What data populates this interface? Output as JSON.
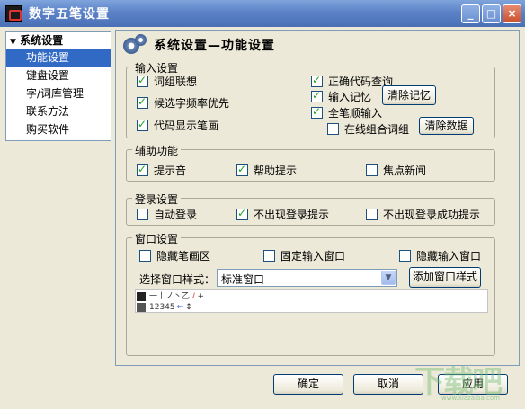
{
  "window": {
    "title": "数字五笔设置",
    "minimize": "_",
    "maximize": "□",
    "close": "×"
  },
  "nav": {
    "header": "系统设置",
    "items": [
      {
        "label": "功能设置",
        "selected": true
      },
      {
        "label": "键盘设置",
        "selected": false
      },
      {
        "label": "字/词库管理",
        "selected": false
      },
      {
        "label": "联系方法",
        "selected": false
      },
      {
        "label": "购买软件",
        "selected": false
      }
    ]
  },
  "panel": {
    "title": "系统设置—功能设置"
  },
  "input_group": {
    "label": "输入设置",
    "options": [
      {
        "label": "词组联想",
        "checked": true
      },
      {
        "label": "候选字频率优先",
        "checked": true
      },
      {
        "label": "代码显示笔画",
        "checked": true
      },
      {
        "label": "正确代码查询",
        "checked": true
      },
      {
        "label": "输入记忆",
        "checked": true
      },
      {
        "label": "全笔顺输入",
        "checked": true
      },
      {
        "label": "在线组合词组",
        "checked": false
      }
    ],
    "clear_memory_button": "清除记忆",
    "clear_data_button": "清除数据"
  },
  "aux_group": {
    "label": "辅助功能",
    "options": [
      {
        "label": "提示音",
        "checked": true
      },
      {
        "label": "帮助提示",
        "checked": true
      },
      {
        "label": "焦点新闻",
        "checked": false
      }
    ]
  },
  "login_group": {
    "label": "登录设置",
    "options": [
      {
        "label": "自动登录",
        "checked": false
      },
      {
        "label": "不出现登录提示",
        "checked": true
      },
      {
        "label": "不出现登录成功提示",
        "checked": false
      }
    ]
  },
  "window_group": {
    "label": "窗口设置",
    "options": [
      {
        "label": "隐藏笔画区",
        "checked": false
      },
      {
        "label": "固定输入窗口",
        "checked": false
      },
      {
        "label": "隐藏输入窗口",
        "checked": false
      }
    ],
    "style_label": "选择窗口样式：",
    "style_value": "标准窗口",
    "add_style_button": "添加窗口样式",
    "preview_row1": "一丨ノ丶乙",
    "preview_row2": "12345"
  },
  "footer": {
    "ok": "确定",
    "cancel": "取消",
    "apply": "应用"
  },
  "watermark": {
    "big": "下载吧",
    "small": "www.xiazaiba.com"
  },
  "colors": {
    "titlebar": "#5b82c7",
    "selection": "#316ac5",
    "check": "#21a121"
  }
}
